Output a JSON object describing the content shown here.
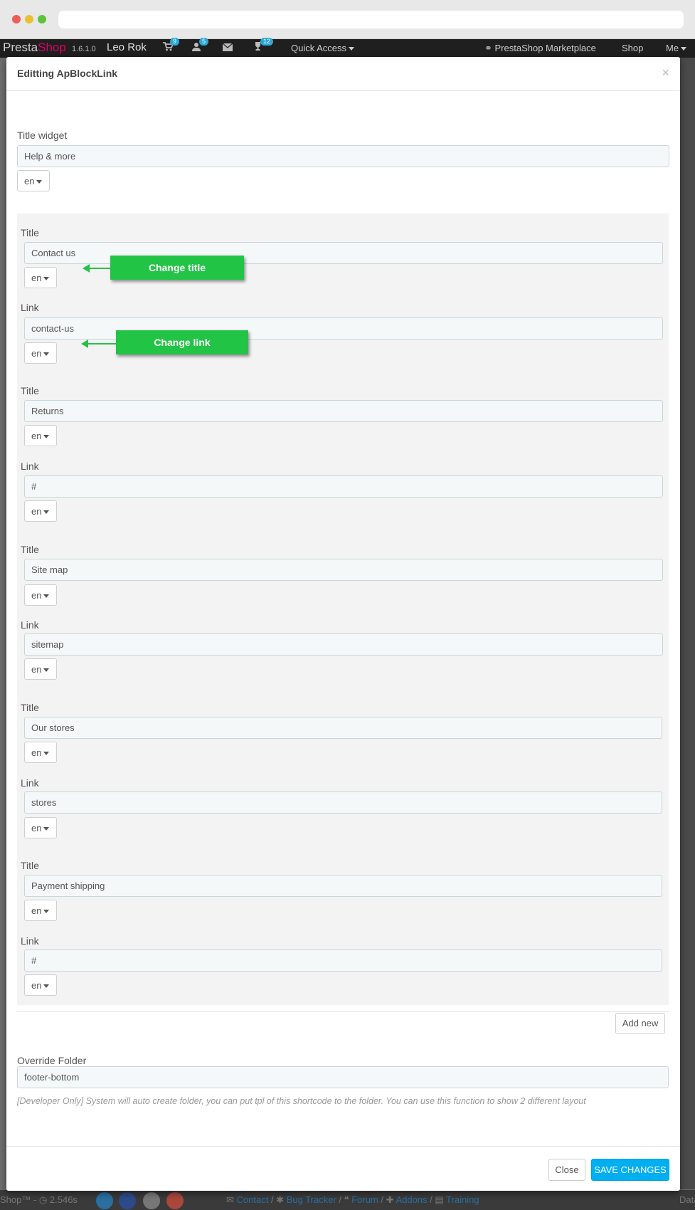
{
  "topbar": {
    "logo_presta": "Presta",
    "logo_shop": "Shop",
    "version": "1.6.1.0",
    "user_name": "Leo Rok",
    "badges": {
      "cart": "9",
      "customers": "5",
      "trophy": "12"
    },
    "quick_access": "Quick Access",
    "marketplace": "PrestaShop Marketplace",
    "shop": "Shop",
    "me": "Me"
  },
  "modal": {
    "title": "Editting ApBlockLink",
    "close_symbol": "×",
    "title_widget_label": "Title widget",
    "title_widget_value": "Help & more",
    "title_widget_lang": "en",
    "links": [
      {
        "title_label": "Title",
        "title": "Contact us",
        "title_lang": "en",
        "link_label": "Link",
        "link": "contact-us",
        "link_lang": "en"
      },
      {
        "title_label": "Title",
        "title": "Returns",
        "title_lang": "en",
        "link_label": "Link",
        "link": "#",
        "link_lang": "en"
      },
      {
        "title_label": "Title",
        "title": "Site map",
        "title_lang": "en",
        "link_label": "Link",
        "link": "sitemap",
        "link_lang": "en"
      },
      {
        "title_label": "Title",
        "title": "Our stores",
        "title_lang": "en",
        "link_label": "Link",
        "link": "stores",
        "link_lang": "en"
      },
      {
        "title_label": "Title",
        "title": "Payment shipping",
        "title_lang": "en",
        "link_label": "Link",
        "link": "#",
        "link_lang": "en"
      }
    ],
    "annotations": {
      "change_title": "Change title",
      "change_link": "Change link"
    },
    "add_new": "Add new",
    "override_label": "Override Folder",
    "override_value": "footer-bottom",
    "override_help": "[Developer Only] System will auto create folder, you can put tpl of this shortcode to the folder. You can use this function to show 2 different layout",
    "close_button": "Close",
    "save_button": "SAVE CHANGES"
  },
  "footer": {
    "shop_text": "Shop™ - ",
    "load_time": "2.546s",
    "links": [
      "Contact",
      "Bug Tracker",
      "Forum",
      "Addons",
      "Training"
    ],
    "separator": " / ",
    "right_text": "Data"
  },
  "colors": {
    "accent": "#00aff0",
    "annotation": "#22c445",
    "brand": "#df0067"
  }
}
